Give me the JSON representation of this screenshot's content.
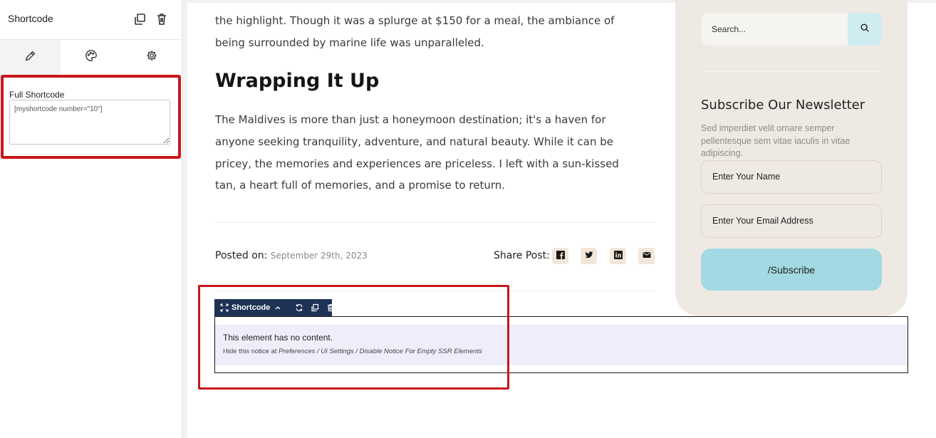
{
  "panel": {
    "title": "Shortcode",
    "header_icons": [
      "copy-icon",
      "trash-icon"
    ],
    "tabs": [
      {
        "name": "pencil-icon",
        "active": true
      },
      {
        "name": "palette-icon",
        "active": false
      },
      {
        "name": "gear-icon",
        "active": false
      }
    ],
    "control": {
      "label": "Full Shortcode",
      "value": "[myshortcode number=\"10\"]"
    }
  },
  "article": {
    "para1_lines": [
      "the highlight. Though it was a splurge at $150 for a meal, the ambiance of",
      "being surrounded by marine life was unparalleled."
    ],
    "heading": "Wrapping It Up",
    "para2_lines": [
      "The Maldives is more than just a honeymoon destination; it's a haven for",
      "anyone seeking tranquility, adventure, and natural beauty. While it can be",
      "pricey, the memories and experiences are priceless. I left with a sun-kissed",
      "tan, a heart full of memories, and a promise to return."
    ],
    "posted_label": "Posted on:",
    "posted_date": "September 29th, 2023",
    "share_label": "Share Post:",
    "share_icons": [
      "facebook-icon",
      "twitter-icon",
      "linkedin-icon",
      "email-icon"
    ]
  },
  "sidebar": {
    "search_placeholder": "Search...",
    "newsletter_title": "Subscribe Our Newsletter",
    "newsletter_desc": "Sed imperdiet velit ornare semper pellentesque sem vitae iaculis in vitae adipiscing.",
    "name_placeholder": "Enter Your Name",
    "email_placeholder": "Enter Your Email Address",
    "subscribe_label": "/Subscribe"
  },
  "shortcode_element": {
    "toolbar_label": "Shortcode",
    "notice_title": "This element has no content.",
    "notice_prefix": "Hide this notice at ",
    "notice_path": "Preferences / UI Settings / Disable Notice For Empty SSR Elements"
  },
  "colors": {
    "highlight": "#c8171c",
    "sidebar_bg": "#efe9e3",
    "subscribe_btn": "#a2d9e2",
    "toolbar": "#1d3255",
    "share_btn_bg": "#f2e6d8"
  }
}
